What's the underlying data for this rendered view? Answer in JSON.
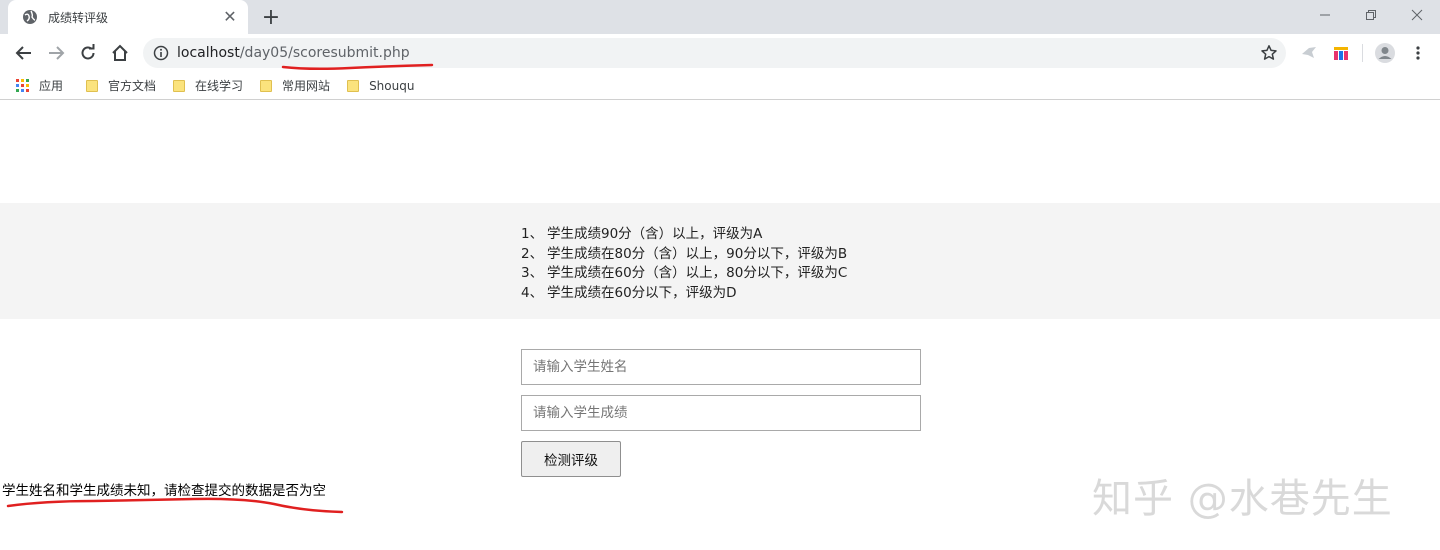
{
  "browser": {
    "tab_title": "成绩转评级",
    "url_host": "localhost",
    "url_path": "/day05/scoresubmit.php",
    "bookmarks": [
      {
        "label": "应用",
        "icon": "apps-grid-icon"
      },
      {
        "label": "官方文档",
        "icon": "folder-icon"
      },
      {
        "label": "在线学习",
        "icon": "folder-icon"
      },
      {
        "label": "常用网站",
        "icon": "folder-icon"
      },
      {
        "label": "Shouqu",
        "icon": "folder-icon"
      }
    ]
  },
  "rules": [
    {
      "num": "1、",
      "text": "学生成绩90分（含）以上，评级为A"
    },
    {
      "num": "2、",
      "text": "学生成绩在80分（含）以上，90分以下，评级为B"
    },
    {
      "num": "3、",
      "text": "学生成绩在60分（含）以上，80分以下，评级为C"
    },
    {
      "num": "4、",
      "text": "学生成绩在60分以下，评级为D"
    }
  ],
  "form": {
    "name_placeholder": "请输入学生姓名",
    "score_placeholder": "请输入学生成绩",
    "submit_label": "检测评级"
  },
  "error_message": "学生姓名和学生成绩未知，请检查提交的数据是否为空",
  "watermark": "知乎 @水巷先生",
  "colors": {
    "annotation_red": "#e02020",
    "band_background": "#f4f4f4"
  }
}
